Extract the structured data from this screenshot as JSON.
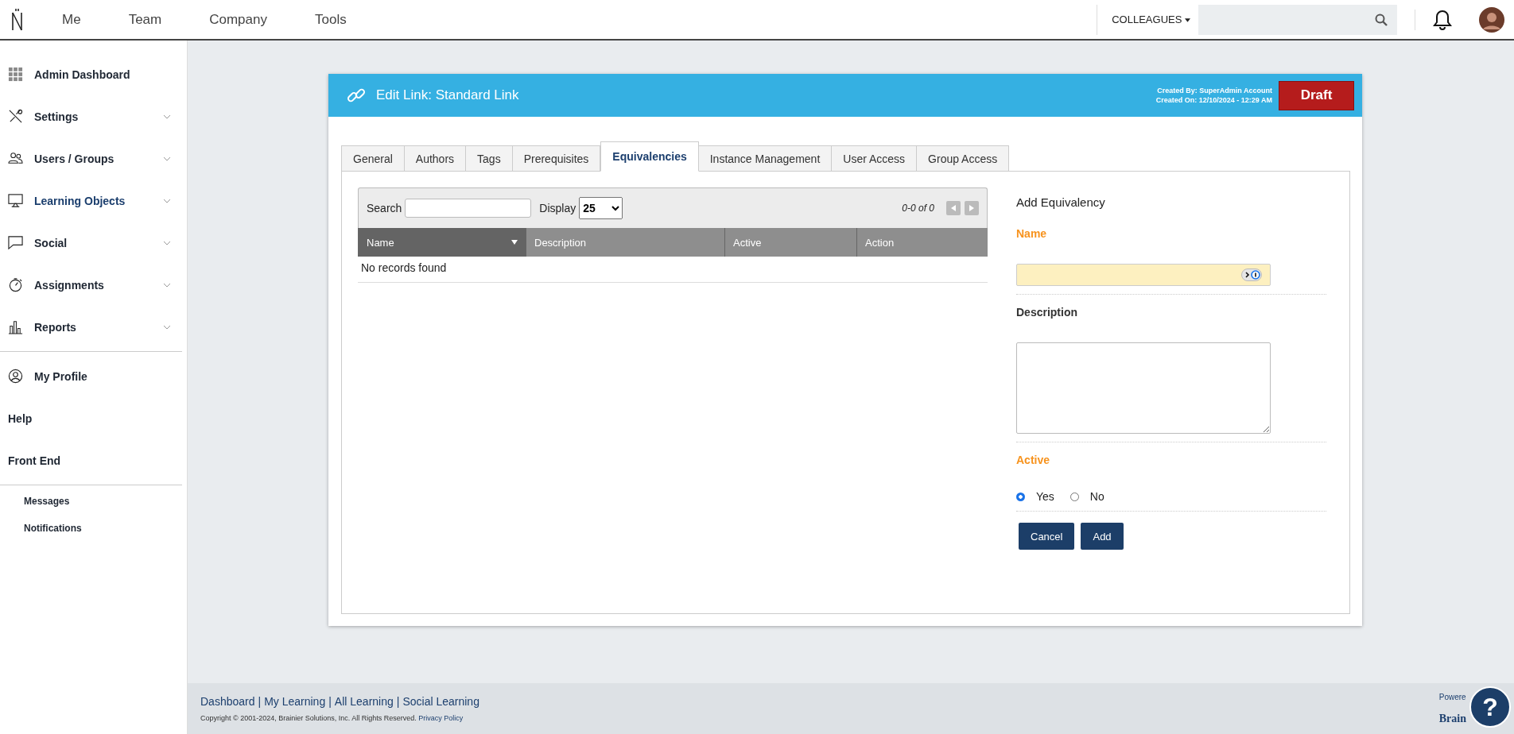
{
  "topnav": {
    "items": [
      {
        "label": "Me"
      },
      {
        "label": "Team"
      },
      {
        "label": "Company"
      },
      {
        "label": "Tools"
      }
    ],
    "scope": "COLLEAGUES"
  },
  "sidebar": {
    "items": [
      {
        "label": "Admin Dashboard",
        "expandable": false,
        "selected": false
      },
      {
        "label": "Settings",
        "expandable": true,
        "selected": false
      },
      {
        "label": "Users / Groups",
        "expandable": true,
        "selected": false
      },
      {
        "label": "Learning Objects",
        "expandable": true,
        "selected": true
      },
      {
        "label": "Social",
        "expandable": true,
        "selected": false
      },
      {
        "label": "Assignments",
        "expandable": true,
        "selected": false
      },
      {
        "label": "Reports",
        "expandable": true,
        "selected": false
      }
    ],
    "profile_items": [
      {
        "label": "My Profile"
      },
      {
        "label": "Help"
      },
      {
        "label": "Front End"
      }
    ],
    "sub_items": [
      {
        "label": "Messages"
      },
      {
        "label": "Notifications"
      }
    ]
  },
  "card": {
    "title": "Edit Link: Standard Link",
    "created_by": "Created By: SuperAdmin Account",
    "created_on": "Created On: 12/10/2024 - 12:29 AM",
    "status": "Draft",
    "tabs": [
      {
        "label": "General",
        "selected": false
      },
      {
        "label": "Authors",
        "selected": false
      },
      {
        "label": "Tags",
        "selected": false
      },
      {
        "label": "Prerequisites",
        "selected": false
      },
      {
        "label": "Equivalencies",
        "selected": true
      },
      {
        "label": "Instance Management",
        "selected": false
      },
      {
        "label": "User Access",
        "selected": false
      },
      {
        "label": "Group Access",
        "selected": false
      }
    ]
  },
  "table": {
    "search_label": "Search",
    "display_label": "Display",
    "display_value": "25",
    "pager": "0-0 of 0",
    "columns": [
      {
        "label": "Name",
        "sorted": true
      },
      {
        "label": "Description",
        "sorted": false
      },
      {
        "label": "Active",
        "sorted": false
      },
      {
        "label": "Action",
        "sorted": false
      }
    ],
    "empty": "No records found"
  },
  "form": {
    "title": "Add Equivalency",
    "name_label": "Name",
    "description_label": "Description",
    "active_label": "Active",
    "options": [
      {
        "label": "Yes",
        "selected": true
      },
      {
        "label": "No",
        "selected": false
      }
    ],
    "buttons": [
      "Cancel",
      "Add"
    ]
  },
  "footer": {
    "links": [
      "Dashboard",
      "My Learning",
      "All Learning",
      "Social Learning"
    ],
    "separators": [
      "|",
      "|",
      "|"
    ],
    "copyright": "Copyright © 2001-2024, Brainier Solutions, Inc. All Rights Reserved.",
    "privacy": "Privacy Policy",
    "powered": "Powere",
    "brand": "Brain",
    "help": "?"
  }
}
